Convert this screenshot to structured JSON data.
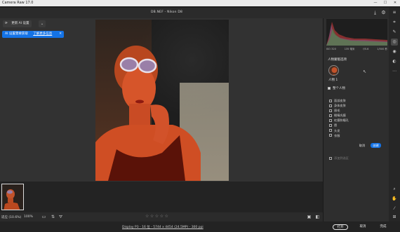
{
  "app": {
    "title": "Camera Raw 17.0"
  },
  "toolbar": {
    "filename": "DB.NEF - Nikon D8"
  },
  "update": {
    "label": "更新 AI 设置"
  },
  "banner": {
    "text": "AI 设置需要获取",
    "link": "了解更多信息"
  },
  "panel": {
    "histogram_readout": [
      "ISO 320",
      "135 毫米",
      "f/5.6",
      "1/500 秒"
    ],
    "section_title": "人物蒙版选项",
    "person_label": "人物 1",
    "whole_person": "整个人物",
    "parts": [
      "面部皮肤",
      "身体皮肤",
      "眉毛",
      "眼睛巩膜",
      "虹膜和瞳孔",
      "唇",
      "头发",
      "衣服"
    ],
    "cancel_label": "取消",
    "create_label": "创建",
    "add_selection": "添加到选区"
  },
  "status": {
    "zoom": "适应 (10.6%)",
    "percent": "100%"
  },
  "rating": {
    "stars": "☆☆☆☆☆",
    "value": 0,
    "max": 5
  },
  "bottom": {
    "file_info": "Display P3 - 16 位 - 5744 x 4454 (24.5MP) - 300 ppi",
    "open_label": "打开",
    "cancel_label": "取消",
    "done_label": "完成"
  },
  "colors": {
    "accent": "#1473e6",
    "panel_bg": "#2e2e2e",
    "canvas_bg": "#323232"
  }
}
